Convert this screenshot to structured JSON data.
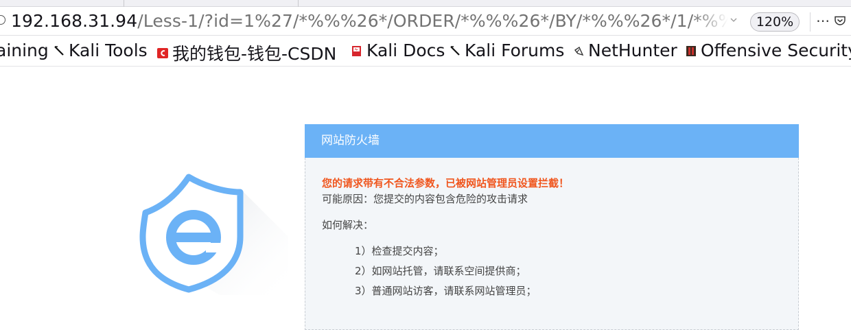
{
  "browser": {
    "url_host": "192.168.31.94",
    "url_path": "/Less-1/?id=1%27/*%%%26*/ORDER/*%%%26*/BY/*%%%26*/1/*%%%",
    "zoom": "120%",
    "menu_glyph": "⋯"
  },
  "bookmarks": [
    {
      "label": "aining",
      "icon": "none"
    },
    {
      "label": "Kali Tools",
      "icon": "kali-dragon-icon"
    },
    {
      "label": "我的钱包-钱包-CSDN",
      "icon": "csdn-icon"
    },
    {
      "label": "Kali Docs",
      "icon": "kali-docs-icon"
    },
    {
      "label": "Kali Forums",
      "icon": "kali-dragon-icon"
    },
    {
      "label": "NetHunter",
      "icon": "nethunter-icon"
    },
    {
      "label": "Offensive Security",
      "icon": "offsec-icon"
    }
  ],
  "firewall": {
    "title": "网站防火墙",
    "alert": "您的请求带有不合法参数，已被网站管理员设置拦截！",
    "reason": "可能原因：您提交的内容包含危险的攻击请求",
    "how": "如何解决：",
    "steps": [
      "1）检查提交内容；",
      "2）如网站托管，请联系空间提供商；",
      "3）普通网站访客，请联系网站管理员；"
    ]
  },
  "colors": {
    "header_blue": "#6bb2f6",
    "alert_orange": "#f0561e",
    "shield_blue": "#6bb2f6"
  }
}
